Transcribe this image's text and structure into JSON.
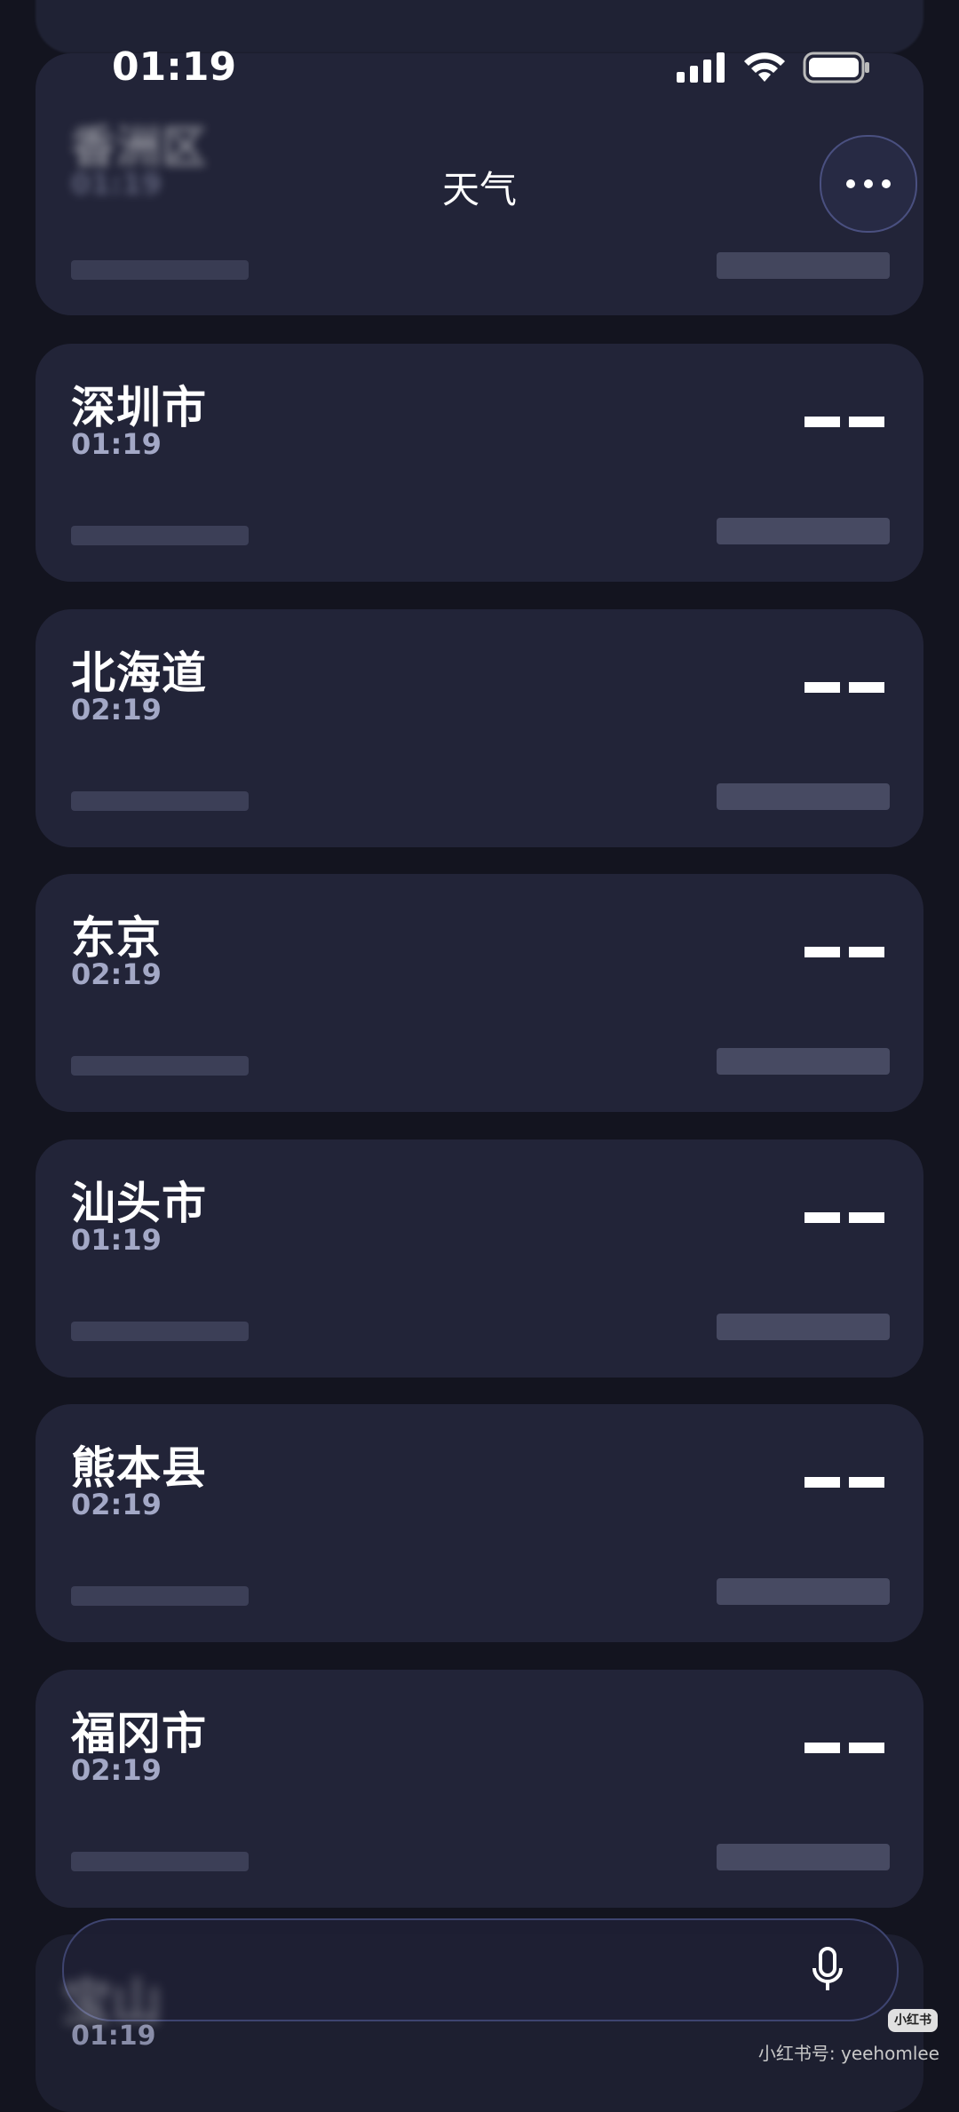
{
  "status_bar": {
    "time": "01:19"
  },
  "header": {
    "title": "天气",
    "more_icon": "ellipsis-icon"
  },
  "cities": [
    {
      "name": "香洲区",
      "time": "01:19"
    },
    {
      "name": "深圳市",
      "time": "01:19",
      "temp": "– –"
    },
    {
      "name": "北海道",
      "time": "02:19",
      "temp": "– –"
    },
    {
      "name": "东京",
      "time": "02:19",
      "temp": "– –"
    },
    {
      "name": "汕头市",
      "time": "01:19",
      "temp": "– –"
    },
    {
      "name": "熊本县",
      "time": "02:19",
      "temp": "– –"
    },
    {
      "name": "福冈市",
      "time": "02:19",
      "temp": "– –"
    },
    {
      "name": "宝山",
      "time": "01:19"
    }
  ],
  "search": {
    "mic_icon": "microphone-icon"
  },
  "watermark": {
    "badge": "小红书",
    "text": "小红书号: yeehomlee"
  }
}
